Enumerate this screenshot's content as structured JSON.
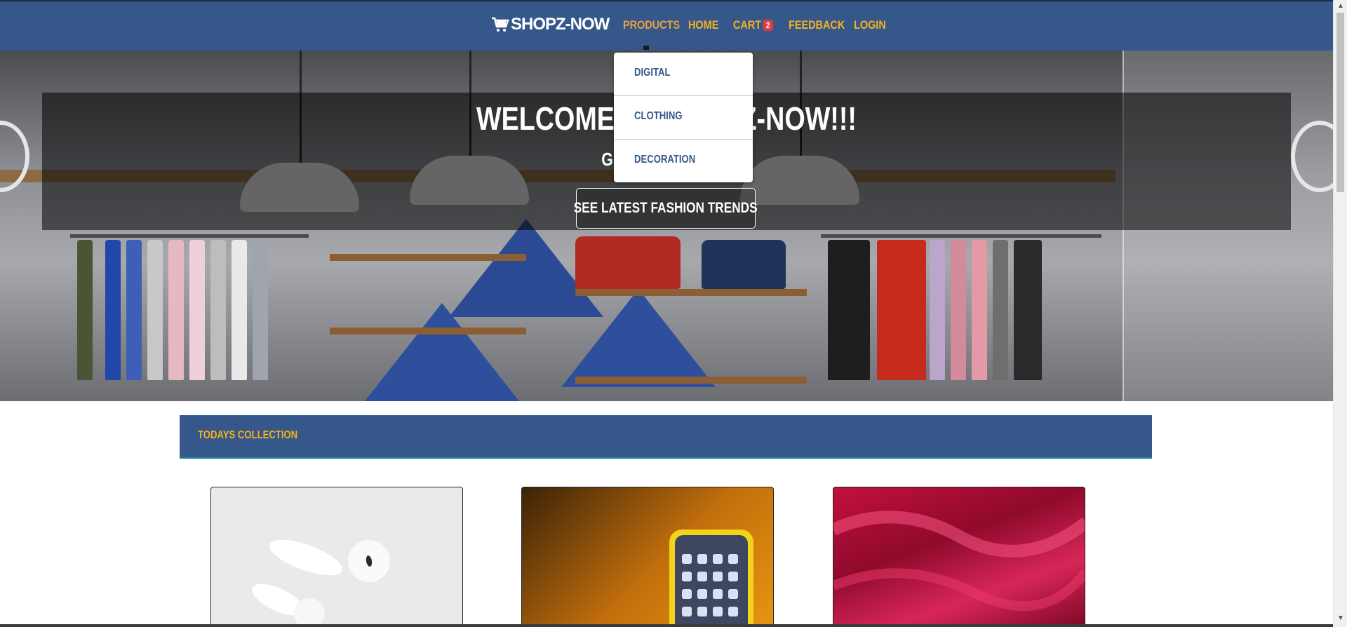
{
  "brand": {
    "name": "SHOPZ-NOW",
    "icon": "shopping-cart-icon"
  },
  "nav": {
    "items": [
      {
        "label": "PRODUCTS",
        "active": true
      },
      {
        "label": "HOME"
      },
      {
        "label": "CART"
      },
      {
        "label": "FEEDBACK"
      },
      {
        "label": "LOGIN"
      }
    ],
    "cart_count": "2"
  },
  "dropdown": {
    "items": [
      "DIGITAL",
      "CLOTHING",
      "DECORATION"
    ]
  },
  "hero": {
    "title": "WELCOME TO SHOPZ-NOW!!!",
    "subtitle": "GET YOUR STYLE",
    "button_label": "SEE LATEST FASHION TRENDS"
  },
  "collection": {
    "header": "TODAYS COLLECTION",
    "cards": [
      {
        "image": "airpods-image"
      },
      {
        "image": "smartphone-image"
      },
      {
        "image": "red-silk-fabric-image"
      }
    ]
  },
  "colors": {
    "navbar": "#36578a",
    "nav_text": "#f4b21e",
    "badge": "#e0393e"
  }
}
